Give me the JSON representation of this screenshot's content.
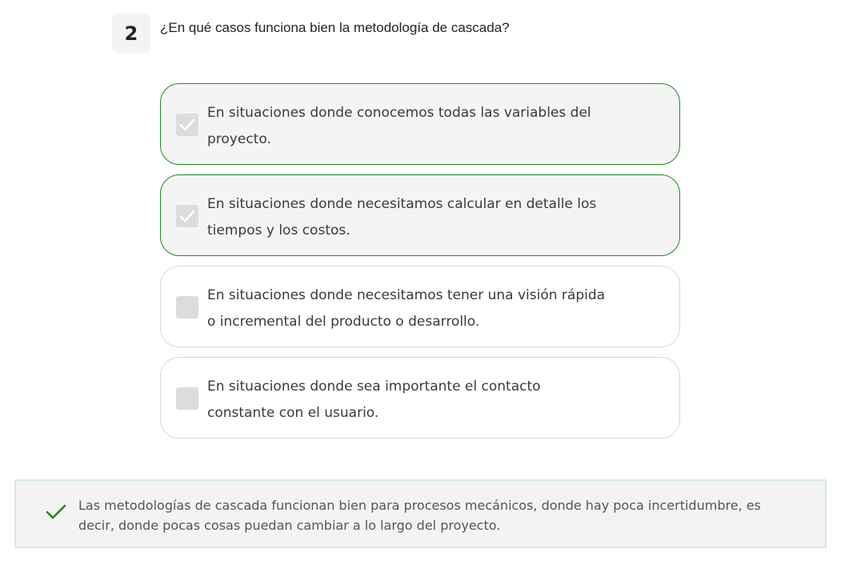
{
  "question": {
    "number": "2",
    "text": "¿En qué casos funciona bien la metodología de cascada?"
  },
  "options": [
    {
      "text": "En situaciones donde conocemos todas las variables del proyecto.",
      "selected": true
    },
    {
      "text": "En situaciones donde necesitamos calcular en detalle los tiempos y los costos.",
      "selected": true
    },
    {
      "text": "En situaciones donde necesitamos tener una visión rápida o incremental del producto o desarrollo.",
      "selected": false
    },
    {
      "text": "En situaciones donde sea importante el contacto constante con el usuario.",
      "selected": false
    }
  ],
  "feedback": {
    "icon": "checkmark-icon",
    "text": "Las metodologías de cascada funcionan bien para procesos mecánicos, donde hay poca incertidumbre, es decir, donde pocas cosas puedan cambiar a lo largo del proyecto."
  },
  "colors": {
    "correct_border": "#1f8a1f",
    "checkmark": "#1f8a1f",
    "checkbox_bg": "#dcdcdc"
  }
}
